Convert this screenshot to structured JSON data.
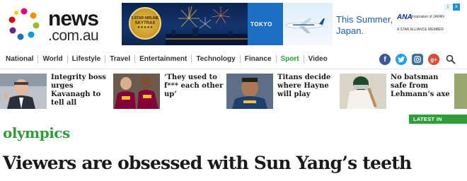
{
  "logo": {
    "name": "news",
    "domain": ".com.au"
  },
  "ad": {
    "badge_top": "5 STAR AIRLINE",
    "badge_brand": "SKYTRAX",
    "badge_stars": "★★★★★",
    "city_label": "TOKYO",
    "headline_line1": "This Summer,",
    "headline_line2": "Japan.",
    "brand": "ANA",
    "tagline": "Inspiration of JAPAN",
    "alliance": "A STAR ALLIANCE MEMBER",
    "close_symbol": "×"
  },
  "nav": {
    "items": [
      {
        "label": "National"
      },
      {
        "label": "World"
      },
      {
        "label": "Lifestyle"
      },
      {
        "label": "Travel"
      },
      {
        "label": "Entertainment"
      },
      {
        "label": "Technology"
      },
      {
        "label": "Finance"
      },
      {
        "label": "Sport",
        "active": true
      },
      {
        "label": "Video"
      }
    ],
    "social": [
      "facebook-icon",
      "twitter-icon",
      "instagram-icon",
      "google-plus-icon",
      "search-icon"
    ]
  },
  "stories": [
    {
      "title": "Integrity boss urges Kavanagh to tell all"
    },
    {
      "title": "‘They used to f*** each other up’"
    },
    {
      "title": "Titans decide where Hayne will play"
    },
    {
      "title": "No batsman safe from Lehmann’s axe"
    }
  ],
  "latest_badge": "LATEST IN SPORT",
  "article": {
    "section": "olympics",
    "headline": "Viewers are obsessed with Sun Yang’s teeth"
  },
  "colors": {
    "accent": "#2f9e3a",
    "text": "#1a1a1a"
  }
}
